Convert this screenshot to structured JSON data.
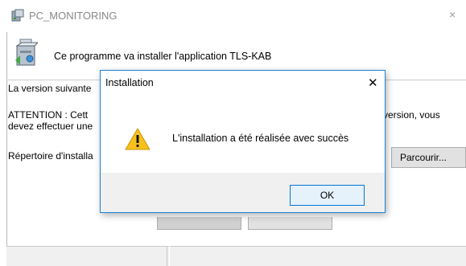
{
  "window": {
    "title": "PC_MONITORING",
    "close_glyph": "×"
  },
  "installer": {
    "install_message": "Ce programme va installer l'application TLS-KAB",
    "version_text": "La version suivante",
    "warning_left_line1": "ATTENTION : Cett",
    "warning_left_line2": "devez effectuer une",
    "warning_right": "e version, vous",
    "directory_text": "Répertoire d'installa",
    "browse_label": "Parcourir..."
  },
  "dialog": {
    "title": "Installation",
    "close_glyph": "✕",
    "message": "L'installation a été réalisée avec succès",
    "ok_label": "OK",
    "icon": "warning-icon"
  },
  "colors": {
    "dialog_border": "#1883d7",
    "warning_yellow": "#f7c11a",
    "ok_border": "#0078d7"
  }
}
